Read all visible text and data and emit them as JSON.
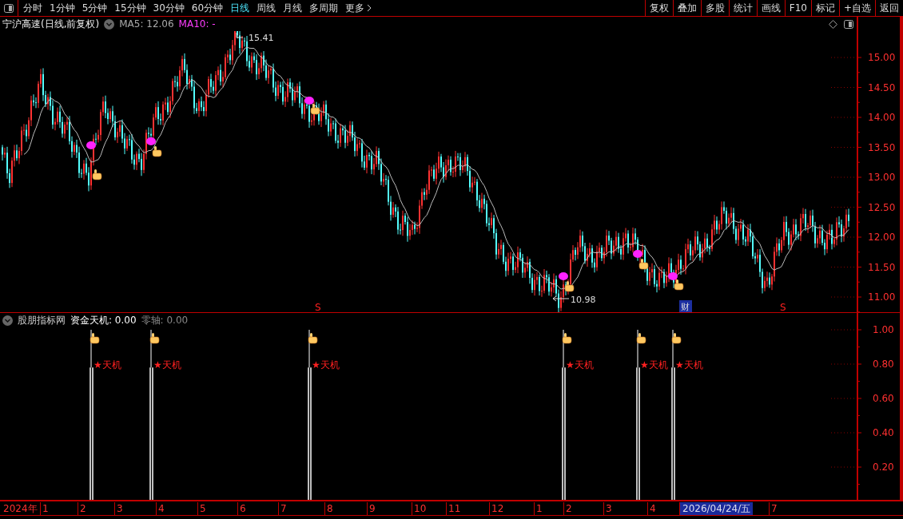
{
  "toolbar": {
    "tabs": [
      {
        "label": "分时",
        "selected": false
      },
      {
        "label": "1分钟",
        "selected": false
      },
      {
        "label": "5分钟",
        "selected": false
      },
      {
        "label": "15分钟",
        "selected": false
      },
      {
        "label": "30分钟",
        "selected": false
      },
      {
        "label": "60分钟",
        "selected": false
      },
      {
        "label": "日线",
        "selected": true
      },
      {
        "label": "周线",
        "selected": false
      },
      {
        "label": "月线",
        "selected": false
      },
      {
        "label": "多周期",
        "selected": false
      },
      {
        "label": "更多",
        "selected": false
      }
    ],
    "buttons": [
      "复权",
      "叠加",
      "多股",
      "统计",
      "画线",
      "F10",
      "标记",
      "+自选",
      "返回"
    ]
  },
  "chart": {
    "title": "宁沪高速(日线,前复权)",
    "ma5": "MA5: 12.06",
    "ma10": "MA10: -",
    "high_label": "15.41",
    "low_label": "10.98",
    "markers": [
      {
        "kind": "s",
        "label": "S"
      },
      {
        "kind": "badge",
        "label": "财"
      },
      {
        "kind": "s",
        "label": "S"
      }
    ],
    "price_axis": [
      "15.00",
      "14.50",
      "14.00",
      "13.50",
      "13.00",
      "12.50",
      "12.00",
      "11.50",
      "11.00"
    ]
  },
  "indicator": {
    "title": "股朋指标网",
    "series": "资金天机: 0.00",
    "zero": "零轴: 0.00",
    "signals": [
      {
        "label": "★天机"
      },
      {
        "label": "★天机"
      },
      {
        "label": "★天机"
      },
      {
        "label": "★天机"
      },
      {
        "label": "★天机"
      },
      {
        "label": "★天机"
      }
    ],
    "axis": [
      "1.00",
      "0.80",
      "0.60",
      "0.40",
      "0.20"
    ]
  },
  "date_axis": [
    {
      "label": "2024年",
      "kind": "year"
    },
    {
      "label": "1",
      "kind": "month"
    },
    {
      "label": "2",
      "kind": "month"
    },
    {
      "label": "3",
      "kind": "month"
    },
    {
      "label": "4",
      "kind": "month"
    },
    {
      "label": "5",
      "kind": "month"
    },
    {
      "label": "6",
      "kind": "month"
    },
    {
      "label": "7",
      "kind": "month"
    },
    {
      "label": "8",
      "kind": "month"
    },
    {
      "label": "9",
      "kind": "month"
    },
    {
      "label": "10",
      "kind": "month"
    },
    {
      "label": "11",
      "kind": "month"
    },
    {
      "label": "12",
      "kind": "month"
    },
    {
      "label": "1",
      "kind": "month"
    },
    {
      "label": "2",
      "kind": "month"
    },
    {
      "label": "3",
      "kind": "month"
    },
    {
      "label": "4",
      "kind": "month"
    },
    {
      "label": "2026/04/24/五",
      "kind": "cursor"
    },
    {
      "label": "7",
      "kind": "month"
    }
  ]
}
